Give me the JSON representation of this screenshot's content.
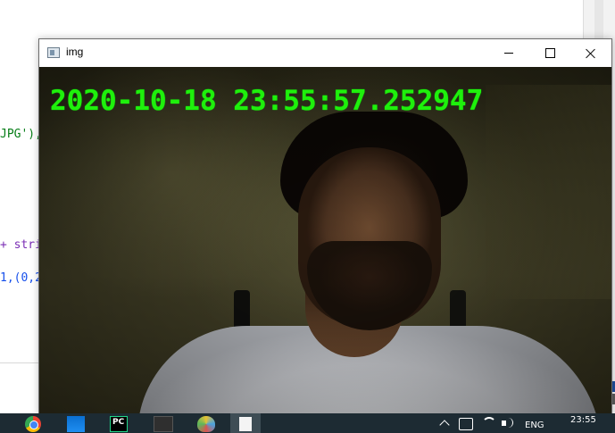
{
  "editor": {
    "lines": [
      {
        "text": "JPG'),",
        "kind": "str"
      },
      {
        "text": "+ stri",
        "kind": "op"
      },
      {
        "text": "1,(0,2",
        "kind": "num"
      }
    ]
  },
  "window": {
    "title": "img",
    "icon": "app-window-icon",
    "controls": {
      "minimize": "minimize-icon",
      "maximize": "maximize-icon",
      "close": "close-icon"
    }
  },
  "frame": {
    "timestamp": "2020-10-18 23:55:57.252947",
    "timestamp_color": "#1ff00c"
  },
  "taskbar": {
    "apps": [
      "chrome-icon",
      "store-icon",
      "pycharm-icon",
      "terminal-icon",
      "paint-icon",
      "file-icon"
    ],
    "pycharm_label": "PC",
    "tray": {
      "language": "ENG",
      "time": "23:55"
    }
  }
}
